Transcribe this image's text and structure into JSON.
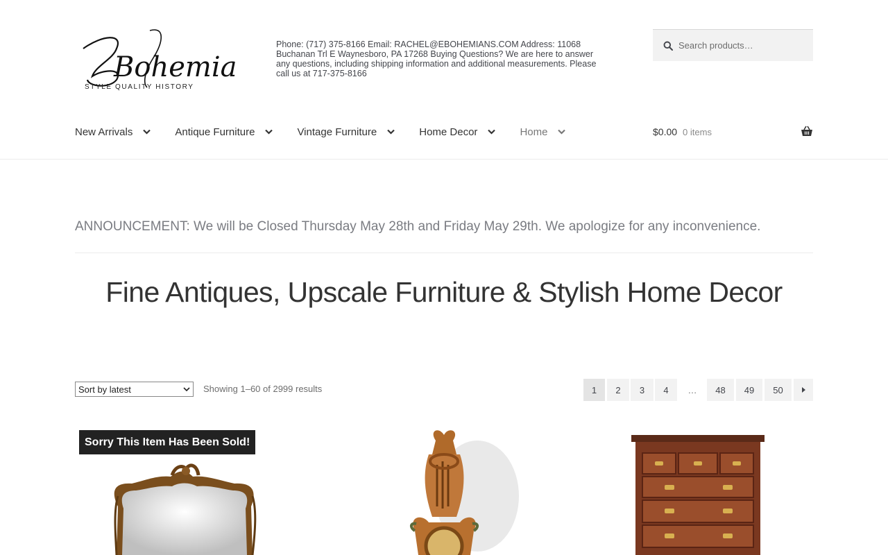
{
  "brand": {
    "logo_text": "Bohemians",
    "tagline": "STYLE QUALITY HISTORY"
  },
  "header": {
    "contact": "Phone: (717) 375-8166 Email: RACHEL@EBOHEMIANS.COM Address: 11068 Buchanan Trl E Waynesboro, PA 17268 Buying Questions? We are here to answer any questions, including shipping information and additional measurements. Please call us at 717-375-8166"
  },
  "search": {
    "placeholder": "Search products…",
    "icon": "search-icon"
  },
  "nav": {
    "items": [
      {
        "label": "New Arrivals"
      },
      {
        "label": "Antique Furniture"
      },
      {
        "label": "Vintage Furniture"
      },
      {
        "label": "Home Decor"
      },
      {
        "label": "Home"
      }
    ]
  },
  "cart": {
    "total": "$0.00",
    "items": "0 items",
    "icon": "basket-icon"
  },
  "announcement": "ANNOUNCEMENT: We will be Closed Thursday May 28th and Friday May 29th. We apologize for any inconvenience.",
  "headline": "Fine Antiques, Upscale Furniture & Stylish Home Decor",
  "toolbar": {
    "sort_selected": "Sort by latest",
    "result_count": "Showing 1–60 of 2999 results"
  },
  "pagination": {
    "pages": [
      "1",
      "2",
      "3",
      "4",
      "…",
      "48",
      "49",
      "50"
    ],
    "current": "1"
  },
  "products": {
    "sold_badge": "Sorry This Item Has Been Sold!"
  },
  "colors": {
    "text": "#43454b",
    "badge_bg": "#222222",
    "pager_bg": "#f2f2f2"
  }
}
